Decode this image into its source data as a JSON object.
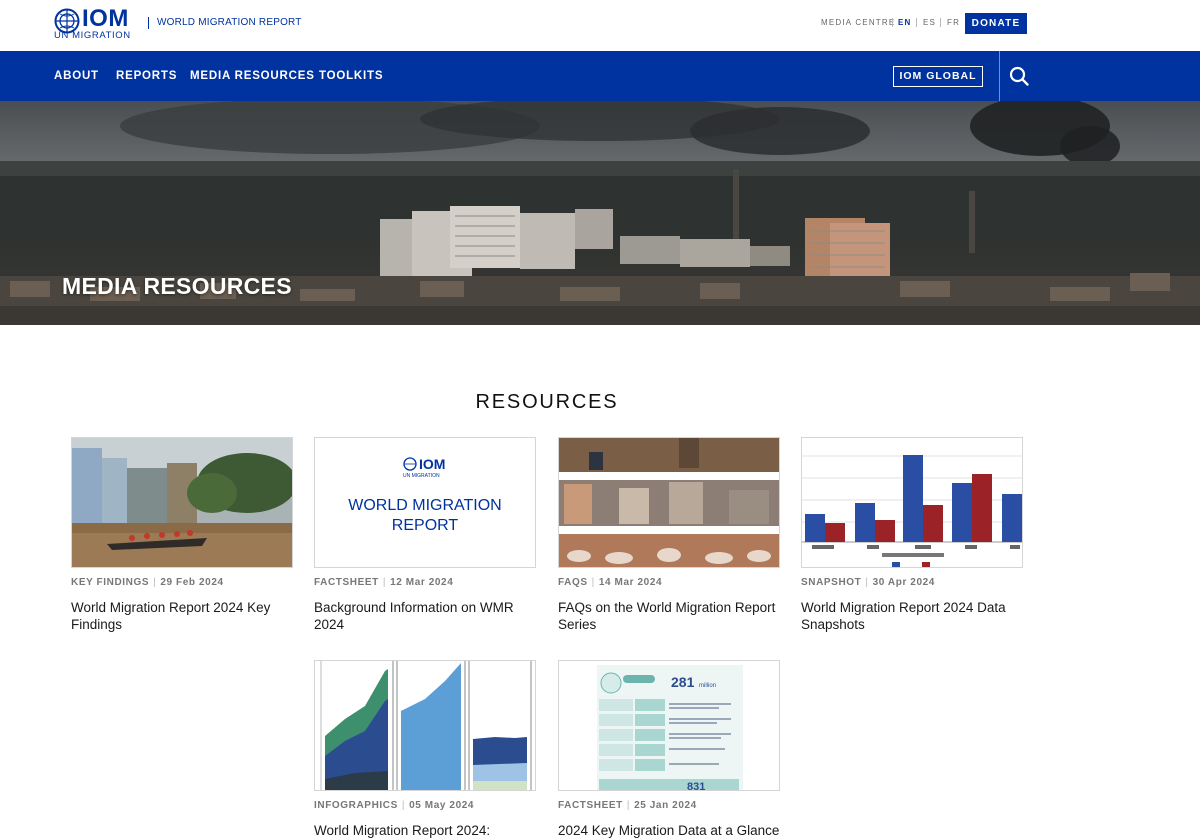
{
  "header": {
    "logo_text": "IOM",
    "logo_subtext": "UN MIGRATION",
    "site_name": "WORLD MIGRATION REPORT",
    "utility_links": [
      "MEDIA CENTRE",
      "EN",
      "ES",
      "FR"
    ],
    "active_language": "EN",
    "donate_label": "DONATE",
    "brand_color": "#0033a0"
  },
  "nav": {
    "items": [
      "ABOUT",
      "REPORTS",
      "MEDIA RESOURCES",
      "TOOLKITS"
    ],
    "global_label": "IOM GLOBAL",
    "search_icon": "search-icon"
  },
  "hero": {
    "title": "MEDIA RESOURCES"
  },
  "resources": {
    "title": "RESOURCES",
    "cards": [
      {
        "category": "KEY FINDINGS",
        "date": "29 Feb 2024",
        "title": "World Migration Report 2024 Key Findings"
      },
      {
        "category": "FACTSHEET",
        "date": "12 Mar 2024",
        "title": "Background Information on WMR 2024",
        "thumb_logo": "IOM",
        "thumb_logo_sub": "UN MIGRATION",
        "thumb_text_1": "WORLD MIGRATION",
        "thumb_text_2": "REPORT"
      },
      {
        "category": "FAQS",
        "date": "14 Mar 2024",
        "title": "FAQs on the World Migration Report Series"
      },
      {
        "category": "SNAPSHOT",
        "date": "30 Apr 2024",
        "title": "World Migration Report 2024 Data Snapshots"
      },
      {
        "category": "INFOGRAPHICS",
        "date": "05 May 2024",
        "title": "World Migration Report 2024:"
      },
      {
        "category": "FACTSHEET",
        "date": "25 Jan 2024",
        "title": "2024 Key Migration Data at a Glance",
        "thumb_big_number": "281",
        "thumb_big_unit": "million",
        "thumb_bottom_number": "831"
      }
    ]
  }
}
